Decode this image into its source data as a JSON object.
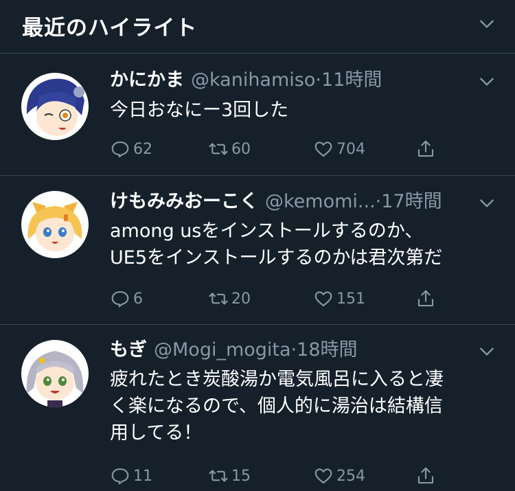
{
  "section": {
    "title": "最近のハイライト",
    "chevron_icon": "chevron-down-icon"
  },
  "colors": {
    "background": "#15202b",
    "divider": "#38444d",
    "secondary": "#8899a6",
    "text": "#ffffff"
  },
  "tweets": [
    {
      "avatar_icon": "avatar-blue-hair-character",
      "display_name": "かにかま",
      "handle": "@kanihamiso",
      "separator": "·",
      "time": "11時間",
      "text": "今日おなにー3回した",
      "replies": "62",
      "retweets": "60",
      "likes": "704"
    },
    {
      "avatar_icon": "avatar-blonde-fox-ear-character",
      "display_name": "けもみみおーこく",
      "handle": "@kemomi...",
      "separator": "·",
      "time": "17時間",
      "text": "among usをインストールするのか、\nUE5をインストールするのかは君次第だ",
      "replies": "6",
      "retweets": "20",
      "likes": "151"
    },
    {
      "avatar_icon": "avatar-grey-hair-character",
      "display_name": "もぎ",
      "handle": "@Mogi_mogita",
      "separator": "·",
      "time": "18時間",
      "text": "疲れたとき炭酸湯か電気風呂に入ると凄\nく楽になるので、個人的に湯治は結構信\n用してる！",
      "replies": "11",
      "retweets": "15",
      "likes": "254"
    }
  ]
}
